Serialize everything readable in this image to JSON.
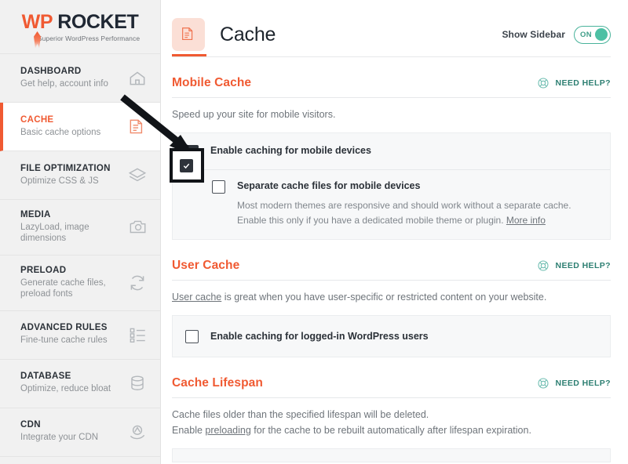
{
  "brand": {
    "name_wp": "WP",
    "name_rocket": "ROCKET",
    "tagline": "Superior WordPress Performance"
  },
  "sidebar": {
    "items": [
      {
        "title": "DASHBOARD",
        "subtitle": "Get help, account info",
        "icon": "home-icon",
        "active": false
      },
      {
        "title": "CACHE",
        "subtitle": "Basic cache options",
        "icon": "document-icon",
        "active": true
      },
      {
        "title": "FILE OPTIMIZATION",
        "subtitle": "Optimize CSS & JS",
        "icon": "layers-icon",
        "active": false
      },
      {
        "title": "MEDIA",
        "subtitle": "LazyLoad, image dimensions",
        "icon": "image-icon",
        "active": false
      },
      {
        "title": "PRELOAD",
        "subtitle": "Generate cache files, preload fonts",
        "icon": "refresh-icon",
        "active": false
      },
      {
        "title": "ADVANCED RULES",
        "subtitle": "Fine-tune cache rules",
        "icon": "list-icon",
        "active": false
      },
      {
        "title": "DATABASE",
        "subtitle": "Optimize, reduce bloat",
        "icon": "database-icon",
        "active": false
      },
      {
        "title": "CDN",
        "subtitle": "Integrate your CDN",
        "icon": "cdn-icon",
        "active": false
      }
    ]
  },
  "header": {
    "title": "Cache",
    "icon": "document-icon",
    "show_sidebar_label": "Show Sidebar",
    "toggle_state": "ON"
  },
  "need_help_label": "NEED HELP?",
  "sections": {
    "mobile_cache": {
      "title": "Mobile Cache",
      "description": "Speed up your site for mobile visitors.",
      "option_main": {
        "label": "Enable caching for mobile devices",
        "checked": true
      },
      "option_sub": {
        "label": "Separate cache files for mobile devices",
        "checked": false,
        "description_part1": "Most modern themes are responsive and should work without a separate cache. Enable this only if you have a dedicated mobile theme or plugin.",
        "description_link": "More info"
      }
    },
    "user_cache": {
      "title": "User Cache",
      "description_link": "User cache",
      "description_rest": " is great when you have user-specific or restricted content on your website.",
      "option": {
        "label": "Enable caching for logged-in WordPress users",
        "checked": false
      }
    },
    "cache_lifespan": {
      "title": "Cache Lifespan",
      "description_line1": "Cache files older than the specified lifespan will be deleted.",
      "description_line2_pre": "Enable ",
      "description_line2_link": "preloading",
      "description_line2_post": " for the cache to be rebuilt automatically after lifespan expiration."
    }
  },
  "colors": {
    "accent_orange": "#f05a32",
    "teal": "#4dc0a4",
    "need_help_teal": "#2d7f72",
    "sidebar_bg": "#f1f1f1",
    "panel_bg": "#f7f8f9"
  },
  "annotations": {
    "arrow": "pointer-arrow",
    "highlight": "checkbox-highlight-box"
  }
}
